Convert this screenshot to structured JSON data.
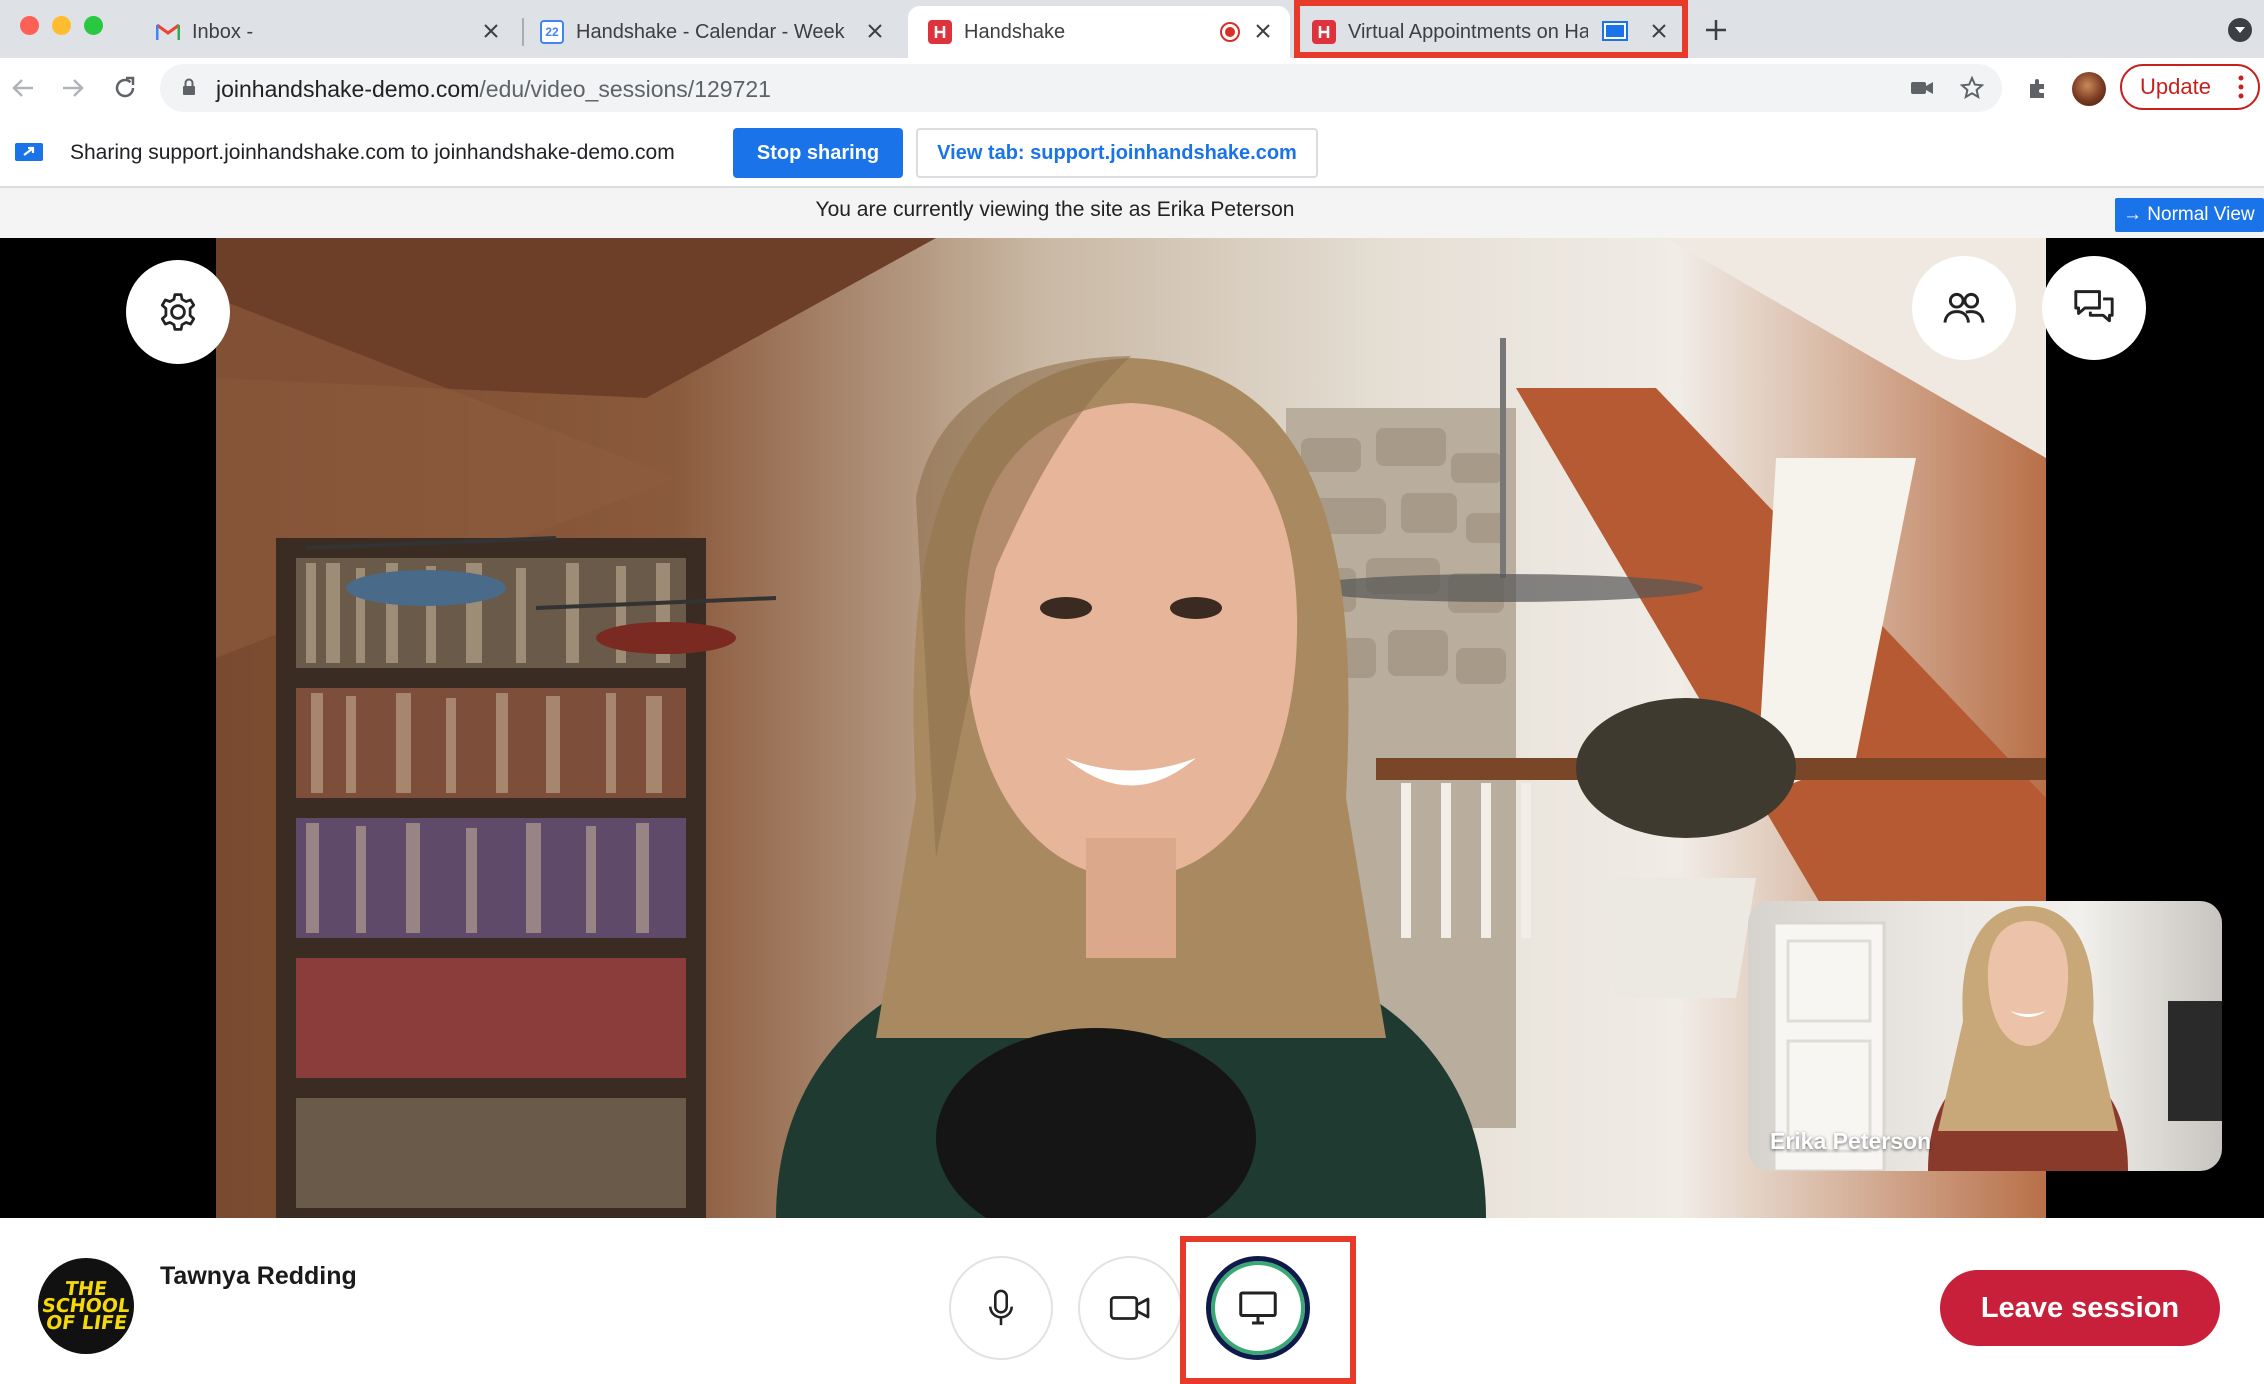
{
  "browser": {
    "tabs": [
      {
        "title": "Inbox -",
        "favicon": "gmail-icon"
      },
      {
        "title": "Handshake - Calendar - Week",
        "favicon": "calendar-icon",
        "favicon_text": "22"
      },
      {
        "title": "Handshake",
        "favicon": "handshake-icon"
      },
      {
        "title": "Virtual Appointments on Ha",
        "favicon": "handshake-icon"
      }
    ],
    "url_host": "joinhandshake-demo.com",
    "url_path": "/edu/video_sessions/129721",
    "update_label": "Update"
  },
  "sharing": {
    "message": "Sharing support.joinhandshake.com to joinhandshake-demo.com",
    "stop_label": "Stop sharing",
    "view_tab_label": "View tab: support.joinhandshake.com"
  },
  "impersonation": {
    "message": "You are currently viewing the site as Erika Peterson",
    "normal_view_label": "→ Normal View"
  },
  "video": {
    "pip_name": "Erika Peterson"
  },
  "footer": {
    "logo_lines": [
      "THE",
      "SCHOOL",
      "OF LIFE"
    ],
    "user_name": "Tawnya Redding",
    "leave_label": "Leave session"
  },
  "colors": {
    "highlight": "#e83a2b",
    "leave": "#c8203a",
    "chrome_blue": "#1a73e8"
  }
}
